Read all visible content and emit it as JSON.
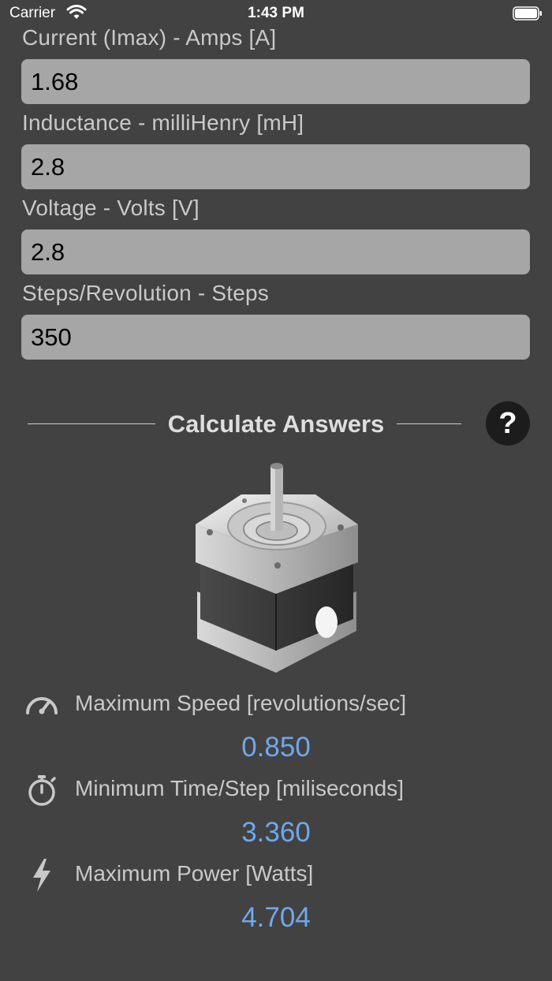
{
  "status_bar": {
    "carrier": "Carrier",
    "time": "1:43 PM"
  },
  "inputs": [
    {
      "label": "Current (Imax) - Amps [A]",
      "value": "1.68"
    },
    {
      "label": "Inductance - milliHenry [mH]",
      "value": "2.8"
    },
    {
      "label": "Voltage - Volts [V]",
      "value": "2.8"
    },
    {
      "label": "Steps/Revolution - Steps",
      "value": "350"
    }
  ],
  "calculate": {
    "label": "Calculate Answers",
    "help_icon": "question-mark-icon"
  },
  "motor_image": "stepper-motor",
  "results": [
    {
      "label": "Maximum Speed [revolutions/sec]",
      "value": "0.850",
      "icon": "speedometer-icon"
    },
    {
      "label": "Minimum Time/Step [miliseconds]",
      "value": "3.360",
      "icon": "stopwatch-icon"
    },
    {
      "label": "Maximum Power [Watts]",
      "value": "4.704",
      "icon": "lightning-bolt-icon"
    }
  ],
  "colors": {
    "background": "#424242",
    "input_fill": "#a6a6a6",
    "result_value": "#6fa8ee",
    "help_button": "#1c1c1c"
  }
}
